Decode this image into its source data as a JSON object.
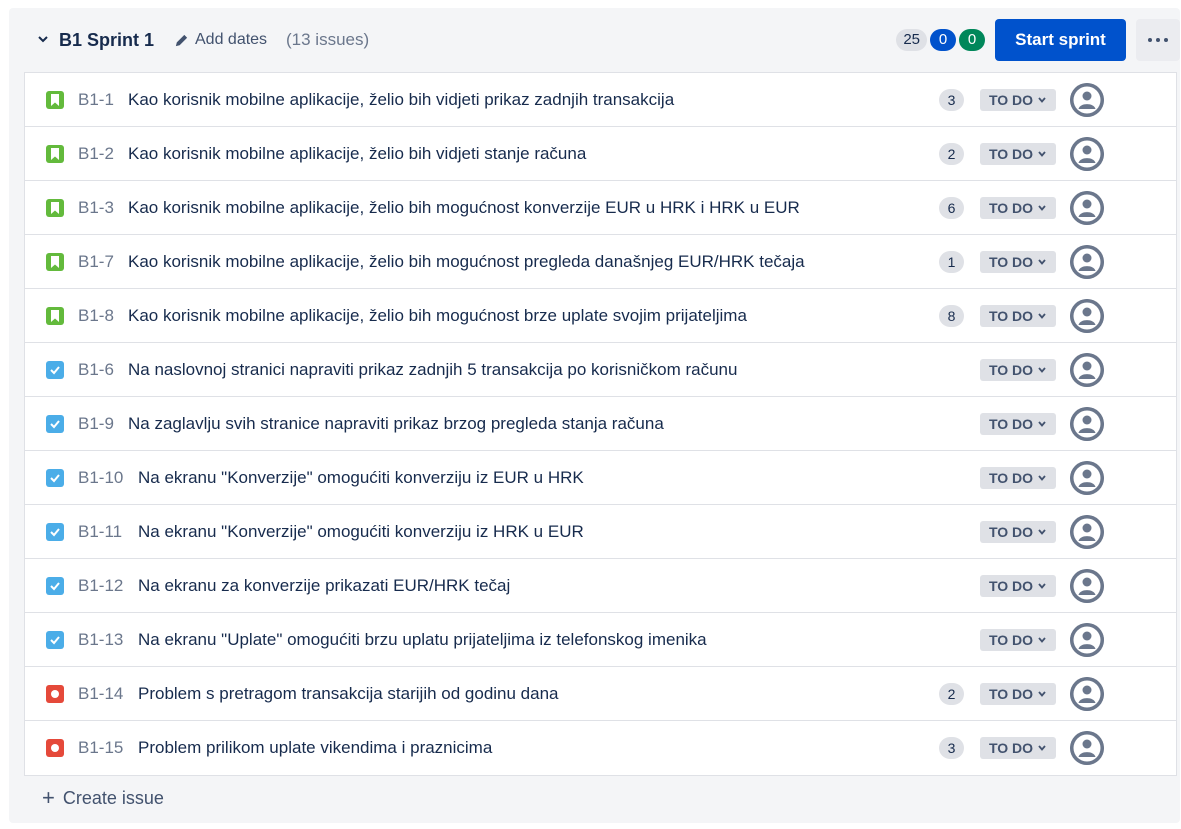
{
  "sprint": {
    "name": "B1 Sprint 1",
    "add_dates_label": "Add dates",
    "issue_count": "(13 issues)",
    "points_total": "25",
    "points_in_progress": "0",
    "points_done": "0",
    "start_button_label": "Start sprint"
  },
  "issues": [
    {
      "type": "story",
      "key": "B1-1",
      "summary": "Kao korisnik mobilne aplikacije, želio bih vidjeti prikaz zadnjih transakcija",
      "estimate": "3",
      "status": "TO DO"
    },
    {
      "type": "story",
      "key": "B1-2",
      "summary": "Kao korisnik mobilne aplikacije, želio bih vidjeti stanje računa",
      "estimate": "2",
      "status": "TO DO"
    },
    {
      "type": "story",
      "key": "B1-3",
      "summary": "Kao korisnik mobilne aplikacije, želio bih mogućnost konverzije EUR u HRK i HRK u EUR",
      "estimate": "6",
      "status": "TO DO"
    },
    {
      "type": "story",
      "key": "B1-7",
      "summary": "Kao korisnik mobilne aplikacije, želio bih mogućnost pregleda današnjeg EUR/HRK tečaja",
      "estimate": "1",
      "status": "TO DO"
    },
    {
      "type": "story",
      "key": "B1-8",
      "summary": "Kao korisnik mobilne aplikacije, želio bih mogućnost brze uplate svojim prijateljima",
      "estimate": "8",
      "status": "TO DO"
    },
    {
      "type": "task",
      "key": "B1-6",
      "summary": "Na naslovnoj stranici napraviti prikaz zadnjih 5 transakcija po korisničkom računu",
      "estimate": "",
      "status": "TO DO"
    },
    {
      "type": "task",
      "key": "B1-9",
      "summary": "Na zaglavlju svih stranice napraviti prikaz brzog pregleda stanja računa",
      "estimate": "",
      "status": "TO DO"
    },
    {
      "type": "task",
      "key": "B1-10",
      "summary": "Na ekranu \"Konverzije\" omogućiti konverziju iz EUR u HRK",
      "estimate": "",
      "status": "TO DO"
    },
    {
      "type": "task",
      "key": "B1-11",
      "summary": "Na ekranu \"Konverzije\" omogućiti konverziju iz HRK u EUR",
      "estimate": "",
      "status": "TO DO"
    },
    {
      "type": "task",
      "key": "B1-12",
      "summary": "Na ekranu za konverzije prikazati EUR/HRK tečaj",
      "estimate": "",
      "status": "TO DO"
    },
    {
      "type": "task",
      "key": "B1-13",
      "summary": "Na ekranu \"Uplate\" omogućiti brzu uplatu prijateljima iz telefonskog imenika",
      "estimate": "",
      "status": "TO DO"
    },
    {
      "type": "bug",
      "key": "B1-14",
      "summary": "Problem s pretragom transakcija starijih od godinu dana",
      "estimate": "2",
      "status": "TO DO"
    },
    {
      "type": "bug",
      "key": "B1-15",
      "summary": "Problem prilikom uplate vikendima i praznicima",
      "estimate": "3",
      "status": "TO DO"
    }
  ],
  "create_issue_label": "Create issue",
  "colors": {
    "primary": "#0052cc",
    "done": "#00875a",
    "story": "#63ba3c",
    "task": "#4bade8",
    "bug": "#e5493a"
  },
  "icons": {
    "collapse": "chevron-down-icon",
    "add_dates": "pencil-icon",
    "more": "more-icon",
    "story": "bookmark-icon",
    "task": "checkbox-icon",
    "bug": "bug-icon",
    "status": "chevron-down-icon",
    "avatar": "user-avatar-icon",
    "create": "plus-icon"
  }
}
